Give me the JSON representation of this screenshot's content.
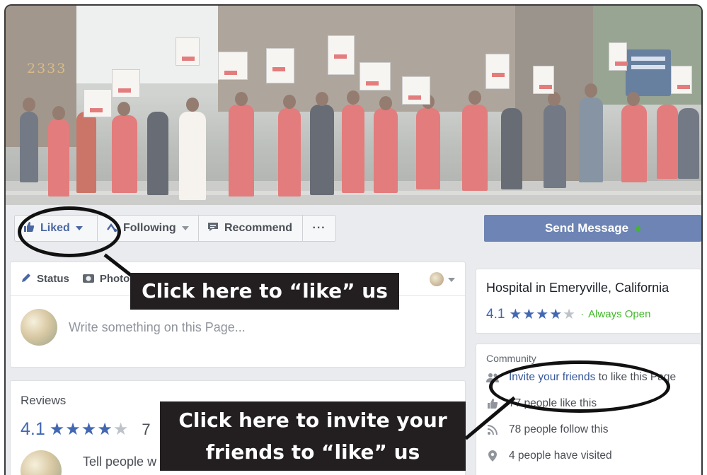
{
  "cover": {
    "address_number": "2333"
  },
  "actions": {
    "liked_label": "Liked",
    "following_label": "Following",
    "recommend_label": "Recommend",
    "more_label": "···",
    "send_message_label": "Send Message"
  },
  "composer": {
    "tabs": [
      {
        "label": "Status",
        "icon": "pencil-icon"
      },
      {
        "label": "Photo",
        "icon": "camera-icon"
      }
    ],
    "placeholder": "Write something on this Page..."
  },
  "reviews": {
    "heading": "Reviews",
    "rating": "4.1",
    "stars_filled": 4,
    "count_partial": "7",
    "prompt_partial": "Tell people w"
  },
  "info": {
    "category": "Hospital in Emeryville, California",
    "rating": "4.1",
    "stars_filled": 4,
    "separator": "·",
    "status": "Always Open"
  },
  "community": {
    "heading": "Community",
    "rows": [
      {
        "icon": "people-icon",
        "link": "Invite your friends",
        "text": " to like this Page"
      },
      {
        "icon": "thumbs-up-icon",
        "link": "",
        "text": "77 people like this"
      },
      {
        "icon": "rss-icon",
        "link": "",
        "text": "78 people follow this"
      },
      {
        "icon": "location-pin-icon",
        "link": "",
        "text": "4 people have visited"
      }
    ]
  },
  "annotations": {
    "like_callout": "Click here to “like” us",
    "invite_callout_line1": "Click here to invite your",
    "invite_callout_line2": "friends to “like” us"
  },
  "colors": {
    "facebook_blue": "#4267b2",
    "send_button": "#6d84b4",
    "online_green": "#42b72a",
    "callout_bg": "#231f20"
  }
}
